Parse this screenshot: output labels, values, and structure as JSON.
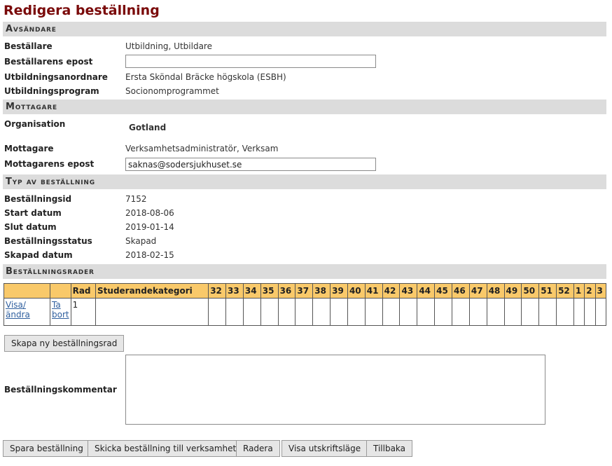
{
  "page": {
    "title": "Redigera beställning"
  },
  "sender": {
    "heading": "Avsändare",
    "orderer_label": "Beställare",
    "orderer_value": "Utbildning, Utbildare",
    "orderer_email_label": "Beställarens epost",
    "orderer_email_value": "",
    "provider_label": "Utbildningsanordnare",
    "provider_value": "Ersta Sköndal Bräcke högskola (ESBH)",
    "program_label": "Utbildningsprogram",
    "program_value": "Socionomprogrammet"
  },
  "receiver": {
    "heading": "Mottagare",
    "org_label": "Organisation",
    "org_value": "Gotland",
    "receiver_label": "Mottagare",
    "receiver_value": "Verksamhetsadministratör, Verksam",
    "receiver_email_label": "Mottagarens epost",
    "receiver_email_value": "saknas@sodersjukhuset.se"
  },
  "order_type": {
    "heading": "Typ av beställning",
    "id_label": "Beställningsid",
    "id_value": "7152",
    "start_label": "Start datum",
    "start_value": "2018-08-06",
    "end_label": "Slut datum",
    "end_value": "2019-01-14",
    "status_label": "Beställningsstatus",
    "status_value": "Skapad",
    "created_label": "Skapad datum",
    "created_value": "2018-02-15"
  },
  "order_rows": {
    "heading": "Beställningsrader",
    "columns": [
      "",
      "",
      "Rad",
      "Studerandekategori",
      "32",
      "33",
      "34",
      "35",
      "36",
      "37",
      "38",
      "39",
      "40",
      "41",
      "42",
      "43",
      "44",
      "45",
      "46",
      "47",
      "48",
      "49",
      "50",
      "51",
      "52",
      "1",
      "2",
      "3"
    ],
    "row": {
      "view_link": "Visa/ändra",
      "remove_link": "Ta bort",
      "rad": "1"
    }
  },
  "buttons": {
    "new_row": "Skapa ny beställningsrad",
    "save": "Spara beställning",
    "send": "Skicka beställning till verksamhet",
    "delete": "Radera",
    "print": "Visa utskriftsläge",
    "back": "Tillbaka"
  },
  "comment": {
    "label": "Beställningskommentar",
    "value": ""
  }
}
